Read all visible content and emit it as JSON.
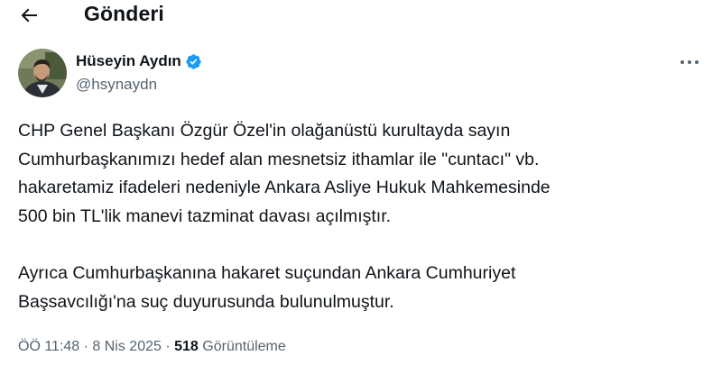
{
  "header": {
    "title": "Gönderi",
    "back_icon": "arrow-left-icon"
  },
  "author": {
    "name": "Hüseyin Aydın",
    "handle": "@hsynaydn",
    "verified": true,
    "verified_color": "#1d9bf0"
  },
  "tweet": {
    "paragraphs": [
      [
        "CHP Genel Başkanı Özgür Özel'in olağanüstü kurultayda sayın",
        "Cumhurbaşkanımızı hedef alan mesnetsiz ithamlar ile \"cuntacı\" vb.",
        "hakaretamiz ifadeleri nedeniyle Ankara Asliye Hukuk Mahkemesinde",
        "500 bin TL'lik manevi tazminat davası açılmıştır."
      ],
      [
        "Ayrıca Cumhurbaşkanına hakaret suçundan Ankara Cumhuriyet",
        "Başsavcılığı'na suç duyurusunda bulunulmuştur."
      ]
    ]
  },
  "meta": {
    "time": "ÖÖ 11:48",
    "separator1": " · ",
    "date": "8 Nis 2025",
    "separator2": " · ",
    "views_count": "518",
    "views_label": " Görüntüleme"
  },
  "colors": {
    "text": "#0f1419",
    "secondary": "#536471",
    "accent": "#1d9bf0"
  }
}
